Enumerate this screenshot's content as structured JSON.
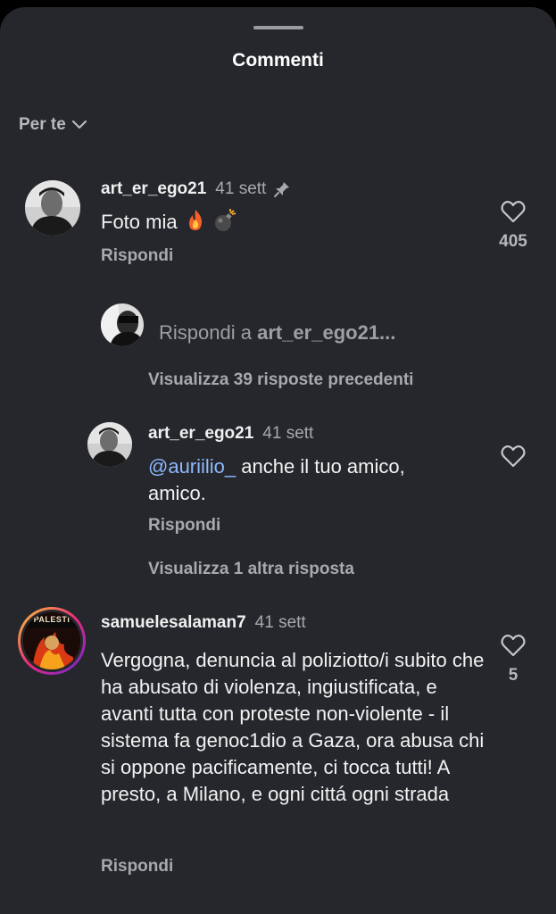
{
  "sheet": {
    "title": "Commenti"
  },
  "sort": {
    "label": "Per te"
  },
  "comments": [
    {
      "username": "art_er_ego21",
      "time": "41 sett",
      "text": "Foto mia",
      "reply_label": "Rispondi",
      "likes": "405"
    },
    {
      "username": "samuelesalaman7",
      "time": "41 sett",
      "text": "Vergogna, denuncia al poliziotto/i subito che ha abusato di violenza, ingiustificata, e avanti tutta con proteste non-violente - il sistema fa genoc1dio a Gaza, ora abusa chi si oppone pacificamente, ci tocca tutti! A presto, a Milano, e ogni cittá ogni strada",
      "reply_label": "Rispondi",
      "likes": "5",
      "avatar_badge": "PALESTI"
    }
  ],
  "reply_composer": {
    "prefix": "Rispondi a",
    "target": "art_er_ego21..."
  },
  "thread": {
    "view_previous": "Visualizza 39 risposte precedenti",
    "reply": {
      "username": "art_er_ego21",
      "time": "41 sett",
      "mention": "@auriilio_",
      "text": "anche il tuo amico,\namico.",
      "reply_label": "Rispondi"
    },
    "view_more": "Visualizza 1 altra risposta"
  },
  "colors": {
    "background": "#25272c",
    "link": "#8fb8ff",
    "muted": "#a6a9ae"
  }
}
